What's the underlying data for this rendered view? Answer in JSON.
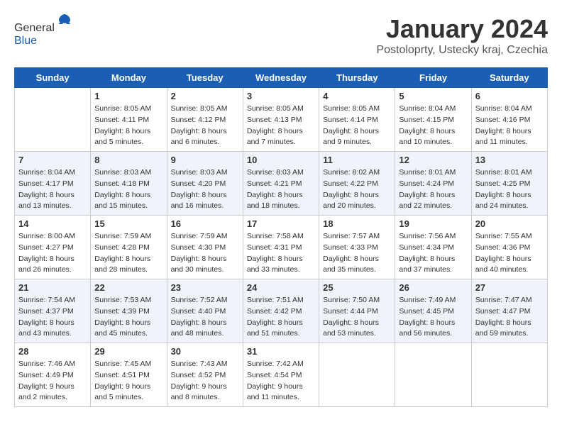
{
  "header": {
    "logo": {
      "general": "General",
      "blue": "Blue"
    },
    "title": "January 2024",
    "subtitle": "Postoloprty, Ustecky kraj, Czechia"
  },
  "days_of_week": [
    "Sunday",
    "Monday",
    "Tuesday",
    "Wednesday",
    "Thursday",
    "Friday",
    "Saturday"
  ],
  "weeks": [
    [
      {
        "day": "",
        "info": ""
      },
      {
        "day": "1",
        "info": "Sunrise: 8:05 AM\nSunset: 4:11 PM\nDaylight: 8 hours\nand 5 minutes."
      },
      {
        "day": "2",
        "info": "Sunrise: 8:05 AM\nSunset: 4:12 PM\nDaylight: 8 hours\nand 6 minutes."
      },
      {
        "day": "3",
        "info": "Sunrise: 8:05 AM\nSunset: 4:13 PM\nDaylight: 8 hours\nand 7 minutes."
      },
      {
        "day": "4",
        "info": "Sunrise: 8:05 AM\nSunset: 4:14 PM\nDaylight: 8 hours\nand 9 minutes."
      },
      {
        "day": "5",
        "info": "Sunrise: 8:04 AM\nSunset: 4:15 PM\nDaylight: 8 hours\nand 10 minutes."
      },
      {
        "day": "6",
        "info": "Sunrise: 8:04 AM\nSunset: 4:16 PM\nDaylight: 8 hours\nand 11 minutes."
      }
    ],
    [
      {
        "day": "7",
        "info": "Sunrise: 8:04 AM\nSunset: 4:17 PM\nDaylight: 8 hours\nand 13 minutes."
      },
      {
        "day": "8",
        "info": "Sunrise: 8:03 AM\nSunset: 4:18 PM\nDaylight: 8 hours\nand 15 minutes."
      },
      {
        "day": "9",
        "info": "Sunrise: 8:03 AM\nSunset: 4:20 PM\nDaylight: 8 hours\nand 16 minutes."
      },
      {
        "day": "10",
        "info": "Sunrise: 8:03 AM\nSunset: 4:21 PM\nDaylight: 8 hours\nand 18 minutes."
      },
      {
        "day": "11",
        "info": "Sunrise: 8:02 AM\nSunset: 4:22 PM\nDaylight: 8 hours\nand 20 minutes."
      },
      {
        "day": "12",
        "info": "Sunrise: 8:01 AM\nSunset: 4:24 PM\nDaylight: 8 hours\nand 22 minutes."
      },
      {
        "day": "13",
        "info": "Sunrise: 8:01 AM\nSunset: 4:25 PM\nDaylight: 8 hours\nand 24 minutes."
      }
    ],
    [
      {
        "day": "14",
        "info": "Sunrise: 8:00 AM\nSunset: 4:27 PM\nDaylight: 8 hours\nand 26 minutes."
      },
      {
        "day": "15",
        "info": "Sunrise: 7:59 AM\nSunset: 4:28 PM\nDaylight: 8 hours\nand 28 minutes."
      },
      {
        "day": "16",
        "info": "Sunrise: 7:59 AM\nSunset: 4:30 PM\nDaylight: 8 hours\nand 30 minutes."
      },
      {
        "day": "17",
        "info": "Sunrise: 7:58 AM\nSunset: 4:31 PM\nDaylight: 8 hours\nand 33 minutes."
      },
      {
        "day": "18",
        "info": "Sunrise: 7:57 AM\nSunset: 4:33 PM\nDaylight: 8 hours\nand 35 minutes."
      },
      {
        "day": "19",
        "info": "Sunrise: 7:56 AM\nSunset: 4:34 PM\nDaylight: 8 hours\nand 37 minutes."
      },
      {
        "day": "20",
        "info": "Sunrise: 7:55 AM\nSunset: 4:36 PM\nDaylight: 8 hours\nand 40 minutes."
      }
    ],
    [
      {
        "day": "21",
        "info": "Sunrise: 7:54 AM\nSunset: 4:37 PM\nDaylight: 8 hours\nand 43 minutes."
      },
      {
        "day": "22",
        "info": "Sunrise: 7:53 AM\nSunset: 4:39 PM\nDaylight: 8 hours\nand 45 minutes."
      },
      {
        "day": "23",
        "info": "Sunrise: 7:52 AM\nSunset: 4:40 PM\nDaylight: 8 hours\nand 48 minutes."
      },
      {
        "day": "24",
        "info": "Sunrise: 7:51 AM\nSunset: 4:42 PM\nDaylight: 8 hours\nand 51 minutes."
      },
      {
        "day": "25",
        "info": "Sunrise: 7:50 AM\nSunset: 4:44 PM\nDaylight: 8 hours\nand 53 minutes."
      },
      {
        "day": "26",
        "info": "Sunrise: 7:49 AM\nSunset: 4:45 PM\nDaylight: 8 hours\nand 56 minutes."
      },
      {
        "day": "27",
        "info": "Sunrise: 7:47 AM\nSunset: 4:47 PM\nDaylight: 8 hours\nand 59 minutes."
      }
    ],
    [
      {
        "day": "28",
        "info": "Sunrise: 7:46 AM\nSunset: 4:49 PM\nDaylight: 9 hours\nand 2 minutes."
      },
      {
        "day": "29",
        "info": "Sunrise: 7:45 AM\nSunset: 4:51 PM\nDaylight: 9 hours\nand 5 minutes."
      },
      {
        "day": "30",
        "info": "Sunrise: 7:43 AM\nSunset: 4:52 PM\nDaylight: 9 hours\nand 8 minutes."
      },
      {
        "day": "31",
        "info": "Sunrise: 7:42 AM\nSunset: 4:54 PM\nDaylight: 9 hours\nand 11 minutes."
      },
      {
        "day": "",
        "info": ""
      },
      {
        "day": "",
        "info": ""
      },
      {
        "day": "",
        "info": ""
      }
    ]
  ]
}
